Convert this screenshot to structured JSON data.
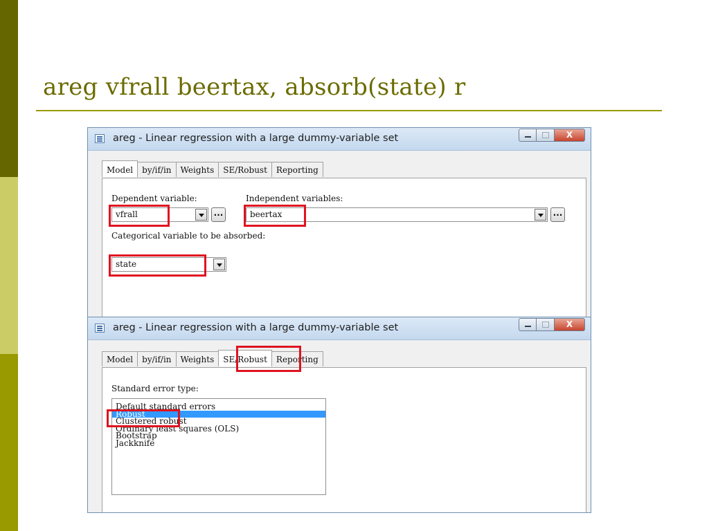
{
  "slide": {
    "title": "areg vfrall beertax, absorb(state) r",
    "accent_colors": [
      "#666600",
      "#cccc66",
      "#999900"
    ]
  },
  "dialog1": {
    "title": "areg - Linear regression with a large dummy-variable set",
    "window_controls": {
      "minimize_icon": "minimize-icon",
      "maximize_icon": "maximize-icon",
      "close_label": "X"
    },
    "tabs": [
      "Model",
      "by/if/in",
      "Weights",
      "SE/Robust",
      "Reporting"
    ],
    "active_tab": "Model",
    "dependent_label": "Dependent variable:",
    "dependent_value": "vfrall",
    "independent_label": "Independent variables:",
    "independent_value": "beertax",
    "ellipsis_label": "...",
    "absorb_label": "Categorical variable to be absorbed:",
    "absorb_value": "state",
    "highlight_color": "#e0121f"
  },
  "dialog2": {
    "title": "areg - Linear regression with a large dummy-variable set",
    "window_controls": {
      "minimize_icon": "minimize-icon",
      "maximize_icon": "maximize-icon",
      "close_label": "X"
    },
    "tabs": [
      "Model",
      "by/if/in",
      "Weights",
      "SE/Robust",
      "Reporting"
    ],
    "active_tab": "SE/Robust",
    "se_type_label": "Standard error type:",
    "se_options": [
      "Default standard errors",
      "Robust",
      "Clustered robust",
      "Ordinary least squares (OLS)",
      "Bootstrap",
      "Jackknife"
    ],
    "selected_option": "Robust",
    "selection_color": "#3399ff"
  }
}
